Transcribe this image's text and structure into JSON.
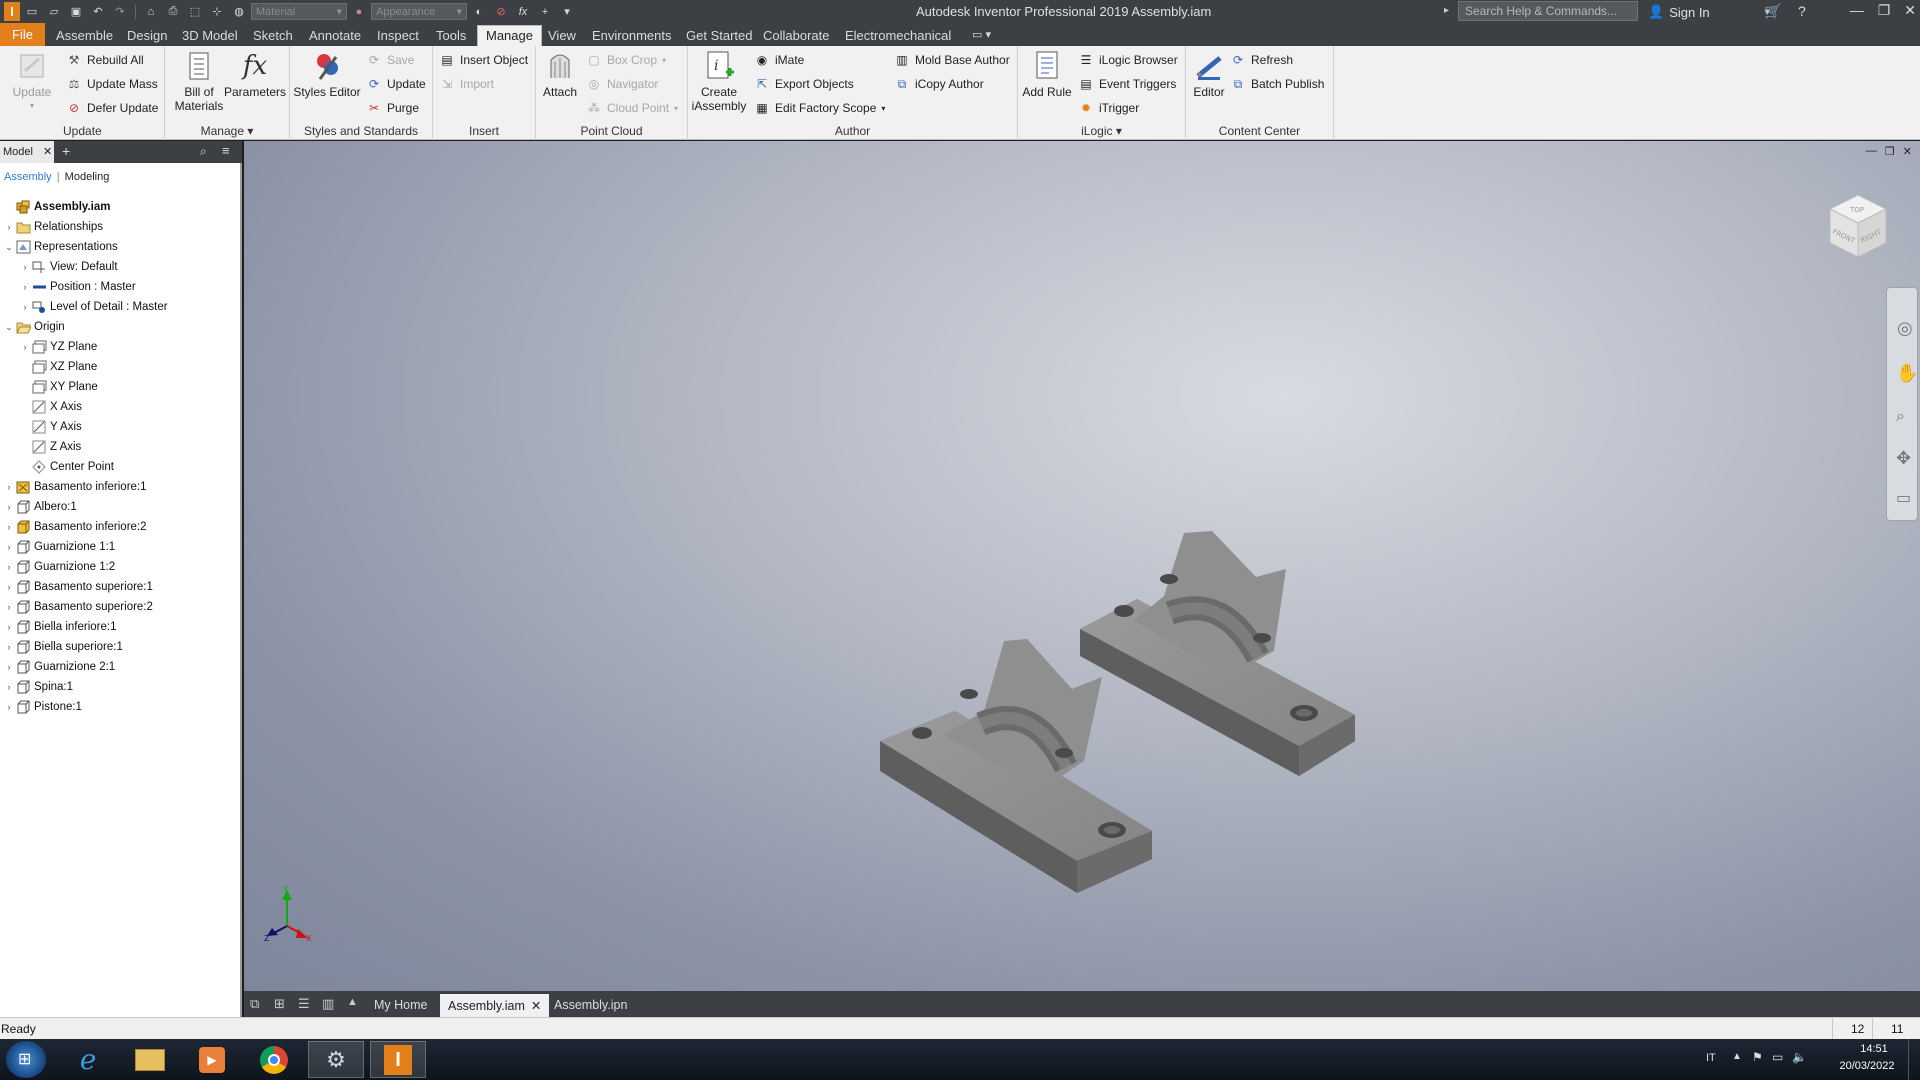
{
  "titlebar": {
    "title": "Autodesk Inventor Professional 2019    Assembly.iam",
    "material_placeholder": "Material",
    "appearance_placeholder": "Appearance",
    "search_placeholder": "Search Help & Commands...",
    "signin_label": "Sign In"
  },
  "tabs": [
    {
      "label": "File"
    },
    {
      "label": "Assemble"
    },
    {
      "label": "Design"
    },
    {
      "label": "3D Model"
    },
    {
      "label": "Sketch"
    },
    {
      "label": "Annotate"
    },
    {
      "label": "Inspect"
    },
    {
      "label": "Tools"
    },
    {
      "label": "Manage"
    },
    {
      "label": "View"
    },
    {
      "label": "Environments"
    },
    {
      "label": "Get Started"
    },
    {
      "label": "Collaborate"
    },
    {
      "label": "Electromechanical"
    }
  ],
  "ribbon": {
    "update": {
      "label": "Update",
      "items": {
        "update": "Update",
        "rebuild_all": "Rebuild All",
        "update_mass": "Update Mass",
        "defer_update": "Defer Update"
      }
    },
    "manage": {
      "label": "Manage ▾",
      "items": {
        "bom": "Bill of\nMaterials",
        "parameters": "Parameters"
      }
    },
    "styles": {
      "label": "Styles and Standards",
      "items": {
        "styles_editor": "Styles Editor",
        "save": "Save",
        "update": "Update",
        "purge": "Purge"
      }
    },
    "insert": {
      "label": "Insert",
      "items": {
        "insert_object": "Insert Object",
        "import": "Import"
      }
    },
    "pointcloud": {
      "label": "Point Cloud",
      "items": {
        "attach": "Attach",
        "box_crop": "Box Crop",
        "navigator": "Navigator",
        "cloud_point": "Cloud Point"
      }
    },
    "author": {
      "label": "Author",
      "items": {
        "create_iassembly": "Create\niAssembly",
        "imate": "iMate",
        "export_objects": "Export Objects",
        "edit_factory_scope": "Edit Factory Scope",
        "mold_base_author": "Mold Base Author",
        "icopy_author": "iCopy Author"
      }
    },
    "ilogic": {
      "label": "iLogic ▾",
      "items": {
        "add_rule": "Add Rule",
        "ilogic_browser": "iLogic Browser",
        "event_triggers": "Event Triggers",
        "itrigger": "iTrigger"
      }
    },
    "content": {
      "label": "Content Center",
      "items": {
        "editor": "Editor",
        "refresh": "Refresh",
        "batch_publish": "Batch Publish"
      }
    }
  },
  "browser": {
    "tab_label": "Model",
    "mode_assembly": "Assembly",
    "mode_modeling": "Modeling",
    "tree": [
      {
        "label": "Assembly.iam",
        "level": 0,
        "exp": "",
        "icon": "assembly-icon",
        "bold": true
      },
      {
        "label": "Relationships",
        "level": 0,
        "exp": "›",
        "icon": "folder-icon"
      },
      {
        "label": "Representations",
        "level": 0,
        "exp": "⌄",
        "icon": "representations-icon"
      },
      {
        "label": "View: Default",
        "level": 1,
        "exp": "›",
        "icon": "view-rep-icon"
      },
      {
        "label": "Position : Master",
        "level": 1,
        "exp": "›",
        "icon": "position-rep-icon"
      },
      {
        "label": "Level of Detail : Master",
        "level": 1,
        "exp": "›",
        "icon": "lod-rep-icon"
      },
      {
        "label": "Origin",
        "level": 0,
        "exp": "⌄",
        "icon": "folder-open-icon"
      },
      {
        "label": "YZ Plane",
        "level": 1,
        "exp": "›",
        "icon": "plane-icon"
      },
      {
        "label": "XZ Plane",
        "level": 1,
        "exp": "",
        "icon": "plane-icon"
      },
      {
        "label": "XY Plane",
        "level": 1,
        "exp": "",
        "icon": "plane-icon"
      },
      {
        "label": "X Axis",
        "level": 1,
        "exp": "",
        "icon": "axis-icon"
      },
      {
        "label": "Y Axis",
        "level": 1,
        "exp": "",
        "icon": "axis-icon"
      },
      {
        "label": "Z Axis",
        "level": 1,
        "exp": "",
        "icon": "axis-icon"
      },
      {
        "label": "Center Point",
        "level": 1,
        "exp": "",
        "icon": "center-point-icon"
      },
      {
        "label": "Basamento inferiore:1",
        "level": 0,
        "exp": "›",
        "icon": "grounded-part-icon"
      },
      {
        "label": "Albero:1",
        "level": 0,
        "exp": "›",
        "icon": "part-icon"
      },
      {
        "label": "Basamento inferiore:2",
        "level": 0,
        "exp": "›",
        "icon": "part-yellow-icon"
      },
      {
        "label": "Guarnizione 1:1",
        "level": 0,
        "exp": "›",
        "icon": "part-icon"
      },
      {
        "label": "Guarnizione 1:2",
        "level": 0,
        "exp": "›",
        "icon": "part-icon"
      },
      {
        "label": "Basamento superiore:1",
        "level": 0,
        "exp": "›",
        "icon": "part-icon"
      },
      {
        "label": "Basamento superiore:2",
        "level": 0,
        "exp": "›",
        "icon": "part-icon"
      },
      {
        "label": "Biella inferiore:1",
        "level": 0,
        "exp": "›",
        "icon": "part-icon"
      },
      {
        "label": "Biella superiore:1",
        "level": 0,
        "exp": "›",
        "icon": "part-icon"
      },
      {
        "label": "Guarnizione 2:1",
        "level": 0,
        "exp": "›",
        "icon": "part-icon"
      },
      {
        "label": "Spina:1",
        "level": 0,
        "exp": "›",
        "icon": "part-icon"
      },
      {
        "label": "Pistone:1",
        "level": 0,
        "exp": "›",
        "icon": "part-icon"
      }
    ]
  },
  "viewcube": {
    "top": "TOP",
    "front": "FRONT",
    "right": "RIGHT"
  },
  "triad": {
    "x": "X",
    "y": "Y",
    "z": "Z"
  },
  "doc_tabs": {
    "home": "My Home",
    "active": "Assembly.iam",
    "other": "Assembly.ipn"
  },
  "status": {
    "text": "Ready",
    "count1": "12",
    "count2": "11"
  },
  "taskbar": {
    "lang": "IT",
    "time": "14:51",
    "date": "20/03/2022"
  },
  "colors": {
    "accent": "#e37f1a",
    "chrome": "#3c3f44",
    "ribbon": "#f1f1f1",
    "part": "#8d8d8d"
  }
}
